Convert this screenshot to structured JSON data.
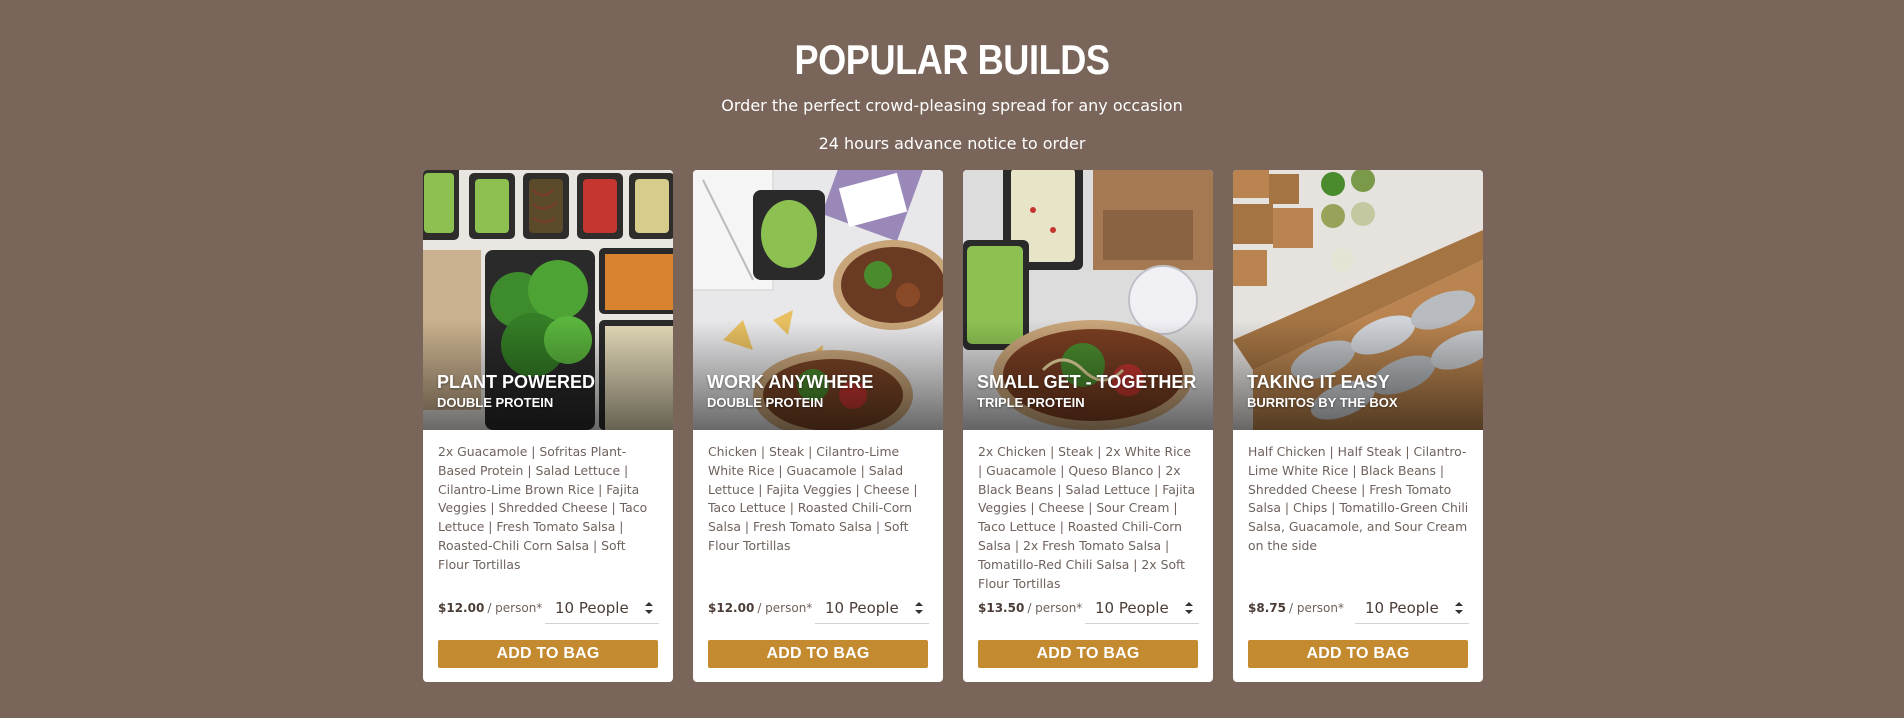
{
  "header": {
    "title": "POPULAR BUILDS",
    "subtitle": "Order the perfect crowd-pleasing spread for any occasion",
    "notice": "24 hours advance notice to order"
  },
  "colors": {
    "background": "#7a655b",
    "button": "#c48a30",
    "card": "#ffffff",
    "text": "#6f625c"
  },
  "cards": [
    {
      "title": "PLANT POWERED",
      "subtitle": "DOUBLE PROTEIN",
      "description": "2x Guacamole | Sofritas Plant-Based Protein | Salad Lettuce | Cilantro-Lime Brown Rice | Fajita Veggies | Shredded Cheese | Taco Lettuce | Fresh Tomato Salsa | Roasted-Chili Corn Salsa | Soft Flour Tortillas",
      "price": "$12.00",
      "per": "/ person*",
      "quantity": "10 People",
      "button": "ADD TO BAG"
    },
    {
      "title": "WORK ANYWHERE",
      "subtitle": "DOUBLE PROTEIN",
      "description": "Chicken | Steak | Cilantro-Lime White Rice | Guacamole | Salad Lettuce | Fajita Veggies | Cheese | Taco Lettuce | Roasted Chili-Corn Salsa | Fresh Tomato Salsa | Soft Flour Tortillas",
      "price": "$12.00",
      "per": "/ person*",
      "quantity": "10 People",
      "button": "ADD TO BAG"
    },
    {
      "title": "SMALL GET - TOGETHER",
      "subtitle": "TRIPLE PROTEIN",
      "description": "2x Chicken | Steak | 2x White Rice | Guacamole | Queso Blanco | 2x Black Beans | Salad Lettuce | Fajita Veggies | Cheese | Sour Cream | Taco Lettuce | Roasted Chili-Corn Salsa | 2x Fresh Tomato Salsa | Tomatillo-Red Chili Salsa | 2x Soft Flour Tortillas",
      "price": "$13.50",
      "per": "/ person*",
      "quantity": "10 People",
      "button": "ADD TO BAG"
    },
    {
      "title": "TAKING IT EASY",
      "subtitle": "BURRITOS BY THE BOX",
      "description": "Half Chicken | Half Steak | Cilantro-Lime White Rice | Black Beans | Shredded Cheese | Fresh Tomato Salsa | Chips | Tomatillo-Green Chili Salsa, Guacamole, and Sour Cream on the side",
      "price": "$8.75",
      "per": "/ person*",
      "quantity": "10 People",
      "button": "ADD TO BAG"
    }
  ]
}
